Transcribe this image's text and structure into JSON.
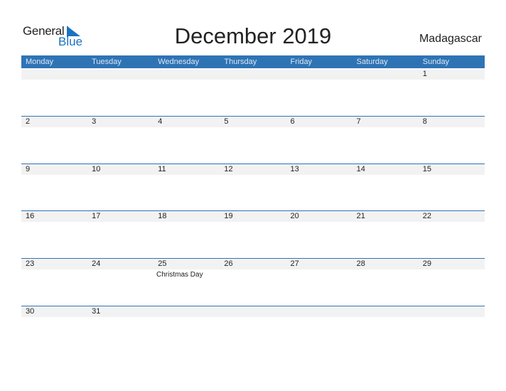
{
  "logo": {
    "word1": "General",
    "word2": "Blue"
  },
  "title": "December 2019",
  "country": "Madagascar",
  "weekdays": [
    "Monday",
    "Tuesday",
    "Wednesday",
    "Thursday",
    "Friday",
    "Saturday",
    "Sunday"
  ],
  "weeks": [
    [
      "",
      "",
      "",
      "",
      "",
      "",
      "1"
    ],
    [
      "2",
      "3",
      "4",
      "5",
      "6",
      "7",
      "8"
    ],
    [
      "9",
      "10",
      "11",
      "12",
      "13",
      "14",
      "15"
    ],
    [
      "16",
      "17",
      "18",
      "19",
      "20",
      "21",
      "22"
    ],
    [
      "23",
      "24",
      "25",
      "26",
      "27",
      "28",
      "29"
    ],
    [
      "30",
      "31",
      "",
      "",
      "",
      "",
      ""
    ]
  ],
  "holidays": [
    {
      "day": "25",
      "name": "Christmas Day"
    }
  ],
  "colors": {
    "accent": "#2e74b5",
    "row_band": "#f2f2f2",
    "logo_blue": "#1a73c0"
  }
}
